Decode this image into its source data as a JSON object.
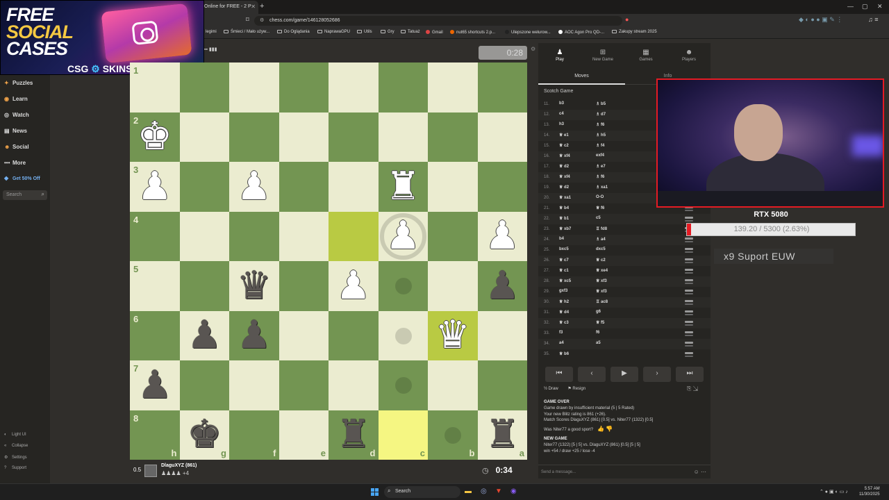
{
  "browser": {
    "tab_title": "Online for FREE - 2 P",
    "url": "chess.com/game/146128052686",
    "bookmarks": [
      "legimi",
      "Śmieci / Mało używ...",
      "Do Oglądania",
      "NaprawaGPU",
      "Utils",
      "Gry",
      "Tatuaż",
      "Gmail",
      "nut65 shortcuts 2.p...",
      "Ulepszone welurow...",
      "AOC Agon Pro QD-...",
      "Zakupy stream 2025"
    ]
  },
  "promo": {
    "line1": "FREE",
    "line2": "SOCIAL",
    "line3": "CASES",
    "brand": "CSG",
    "brand_mark": "⚙",
    "brand2": "SKINS"
  },
  "sidebar": {
    "items": [
      {
        "label": "Puzzles",
        "icon": "puzzle-icon"
      },
      {
        "label": "Learn",
        "icon": "learn-icon"
      },
      {
        "label": "Watch",
        "icon": "watch-icon"
      },
      {
        "label": "News",
        "icon": "news-icon"
      },
      {
        "label": "Social",
        "icon": "social-icon"
      },
      {
        "label": "More",
        "icon": "more-icon"
      },
      {
        "label": "Get 50% Off",
        "icon": "diamond-icon"
      }
    ],
    "search_placeholder": "Search",
    "footer": [
      "Light UI",
      "Collapse",
      "Settings",
      "Support"
    ]
  },
  "board": {
    "ranks": [
      "1",
      "2",
      "3",
      "4",
      "5",
      "6",
      "7",
      "8"
    ],
    "files": [
      "h",
      "g",
      "f",
      "e",
      "d",
      "c",
      "b",
      "a"
    ],
    "pieces": [
      {
        "sq": "h2",
        "glyph": "♚",
        "color": "w"
      },
      {
        "sq": "h3",
        "glyph": "♟",
        "color": "w"
      },
      {
        "sq": "f3",
        "glyph": "♟",
        "color": "w"
      },
      {
        "sq": "c3",
        "glyph": "♜",
        "color": "w"
      },
      {
        "sq": "c4",
        "glyph": "♟",
        "color": "w"
      },
      {
        "sq": "a4",
        "glyph": "♟",
        "color": "w"
      },
      {
        "sq": "f5",
        "glyph": "♛",
        "color": "b"
      },
      {
        "sq": "d5",
        "glyph": "♟",
        "color": "w"
      },
      {
        "sq": "a5",
        "glyph": "♟",
        "color": "b"
      },
      {
        "sq": "g6",
        "glyph": "♟",
        "color": "b"
      },
      {
        "sq": "f6",
        "glyph": "♟",
        "color": "b"
      },
      {
        "sq": "b6",
        "glyph": "♛",
        "color": "w"
      },
      {
        "sq": "h7",
        "glyph": "♟",
        "color": "b"
      },
      {
        "sq": "g8",
        "glyph": "♚",
        "color": "b"
      },
      {
        "sq": "d8",
        "glyph": "♜",
        "color": "b"
      },
      {
        "sq": "a8",
        "glyph": "♜",
        "color": "b"
      }
    ],
    "highlights": [
      "d4",
      "b6",
      "c8"
    ],
    "hints": [
      "c5",
      "c6",
      "c7",
      "b8"
    ],
    "capture_ring": [
      "c4"
    ]
  },
  "clocks": {
    "opponent_time": "0:28",
    "player_time": "0:34"
  },
  "player": {
    "rating_diff": "0.5",
    "name": "DlaguXYZ (861)",
    "captured": "♟♟♟♟ +4"
  },
  "panel": {
    "tabs": [
      "Play",
      "New Game",
      "Games",
      "Players"
    ],
    "subtabs": [
      "Moves",
      "Info"
    ],
    "opening": "Scotch Game",
    "moves": [
      {
        "n": "11.",
        "w": "b3",
        "b": "♗ b5"
      },
      {
        "n": "12.",
        "w": "c4",
        "b": "♗ d7"
      },
      {
        "n": "13.",
        "w": "h3",
        "b": "♗ f6"
      },
      {
        "n": "14.",
        "w": "♕ e1",
        "b": "♗ h5"
      },
      {
        "n": "15.",
        "w": "♕ c2",
        "b": "♗ f4"
      },
      {
        "n": "16.",
        "w": "♕ xf4",
        "b": "exf4"
      },
      {
        "n": "17.",
        "w": "♕ d2",
        "b": "♗ e7"
      },
      {
        "n": "18.",
        "w": "♕ xf4",
        "b": "♗ f6"
      },
      {
        "n": "19.",
        "w": "♕ d2",
        "b": "♗ xa1"
      },
      {
        "n": "20.",
        "w": "♕ xa1",
        "b": "O-O"
      },
      {
        "n": "21.",
        "w": "♕ b4",
        "b": "♕ f6"
      },
      {
        "n": "22.",
        "w": "♕ b1",
        "b": "c5"
      },
      {
        "n": "23.",
        "w": "♕ xb7",
        "b": "♖ fd8"
      },
      {
        "n": "24.",
        "w": "b4",
        "b": "♗ a4"
      },
      {
        "n": "25.",
        "w": "bxc5",
        "b": "dxc5"
      },
      {
        "n": "26.",
        "w": "♕ c7",
        "b": "♕ c2"
      },
      {
        "n": "27.",
        "w": "♕ c1",
        "b": "♕ xe4"
      },
      {
        "n": "28.",
        "w": "♕ xc5",
        "b": "♕ xf3"
      },
      {
        "n": "29.",
        "w": "gxf3",
        "b": "♕ xf3"
      },
      {
        "n": "30.",
        "w": "♕ h2",
        "b": "♖ ac8"
      },
      {
        "n": "31.",
        "w": "♕ d4",
        "b": "g6"
      },
      {
        "n": "32.",
        "w": "♕ c3",
        "b": "♕ f5"
      },
      {
        "n": "33.",
        "w": "f3",
        "b": "f6"
      },
      {
        "n": "34.",
        "w": "a4",
        "b": "a5"
      },
      {
        "n": "35.",
        "w": "♕ b6",
        "b": ""
      }
    ],
    "nav": [
      "⏮",
      "‹",
      "▶",
      "›",
      "⏭"
    ],
    "actions": [
      "½ Draw",
      "⚑ Resign"
    ],
    "gameover_title": "GAME OVER",
    "gameover_lines": [
      "Game drawn by insufficient material (5 | 5 Rated)",
      "Your new Blitz rating is 861 (+26).",
      "Match Scores DlaguXYZ (861) [0.5] vs. Niter77 (1322) [0.5]"
    ],
    "sport_question": "Was Niter77 a good sport?",
    "newgame_title": "NEW GAME",
    "newgame_lines": [
      "Niter77 (1322) [5 | 5] vs. DlaguXYZ (861) [0.5] [5 | 5]",
      "win +54 / draw +25 / lose -4"
    ],
    "message_placeholder": "Send a message..."
  },
  "stream": {
    "gpu_title": "RTX 5080",
    "gpu_progress_text": "139.20 / 5300 (2.63%)",
    "gpu_progress": 0.0263,
    "support_text": "x9 Suport  EUW",
    "accent": "#e51b23"
  },
  "taskbar": {
    "search": "Search",
    "time": "5:57 AM",
    "date": "11/30/2025"
  }
}
